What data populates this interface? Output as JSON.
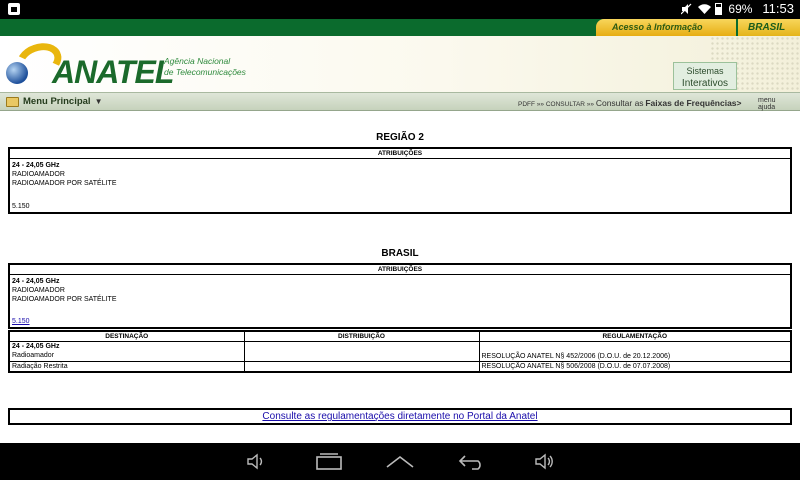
{
  "status_bar": {
    "battery": "69%",
    "time": "11:53"
  },
  "top_bar": {
    "acesso_label": "Acesso à Informação",
    "brasil_label": "BRASIL"
  },
  "header": {
    "logo_text": "ANATEL",
    "logo_sub_line1": "Agência Nacional",
    "logo_sub_line2": "de Telecomunicações",
    "sistemas_line1": "Sistemas",
    "sistemas_line2": "Interativos"
  },
  "menu_bar": {
    "menu_label": "Menu Principal",
    "crumb_pdff": "PDFF",
    "crumb_sep1": "»»",
    "crumb_consultar": "CONSULTAR",
    "crumb_sep2": "»»",
    "crumb_consultar_as": "Consultar as",
    "crumb_current": "Faixas de Frequências>",
    "help_menu": "menu",
    "help_ajuda": "ajuda"
  },
  "regiao": {
    "title": "REGIÃO 2",
    "header": "ATRIBUIÇÕES",
    "band": "24 - 24,05 GHz",
    "line1": "RADIOAMADOR",
    "line2": "RADIOAMADOR POR SATÉLITE",
    "note": "5.150"
  },
  "brasil": {
    "title": "BRASIL",
    "header": "ATRIBUIÇÕES",
    "band": "24 - 24,05 GHz",
    "line1": "RADIOAMADOR",
    "line2": "RADIOAMADOR POR SATÉLITE",
    "note": "5.150",
    "table": {
      "col_destinacao": "DESTINAÇÃO",
      "col_distribuicao": "DISTRIBUIÇÃO",
      "col_regulamentacao": "REGULAMENTAÇÃO",
      "band": "24 - 24,05 GHz",
      "rows": [
        {
          "destinacao": "Radioamador",
          "distribuicao": "",
          "regulamentacao": "RESOLUÇÃO ANATEL N§ 452/2006 (D.O.U. de 20.12.2006)"
        },
        {
          "destinacao": "Radiação Restrita",
          "distribuicao": "",
          "regulamentacao": "RESOLUÇÃO ANATEL N§ 506/2008 (D.O.U. de 07.07.2008)"
        }
      ]
    }
  },
  "consulte_link": "Consulte as regulamentações diretamente no Portal da Anatel",
  "colors": {
    "brand_green": "#0b6b2d",
    "brand_yellow": "#e9b60d",
    "link_blue": "#1a0dab"
  },
  "icons": [
    "notification-icon",
    "mute-icon",
    "wifi-icon",
    "battery-icon",
    "folder-icon",
    "volume-down-icon",
    "recent-apps-icon",
    "home-icon",
    "back-icon",
    "volume-up-icon"
  ]
}
